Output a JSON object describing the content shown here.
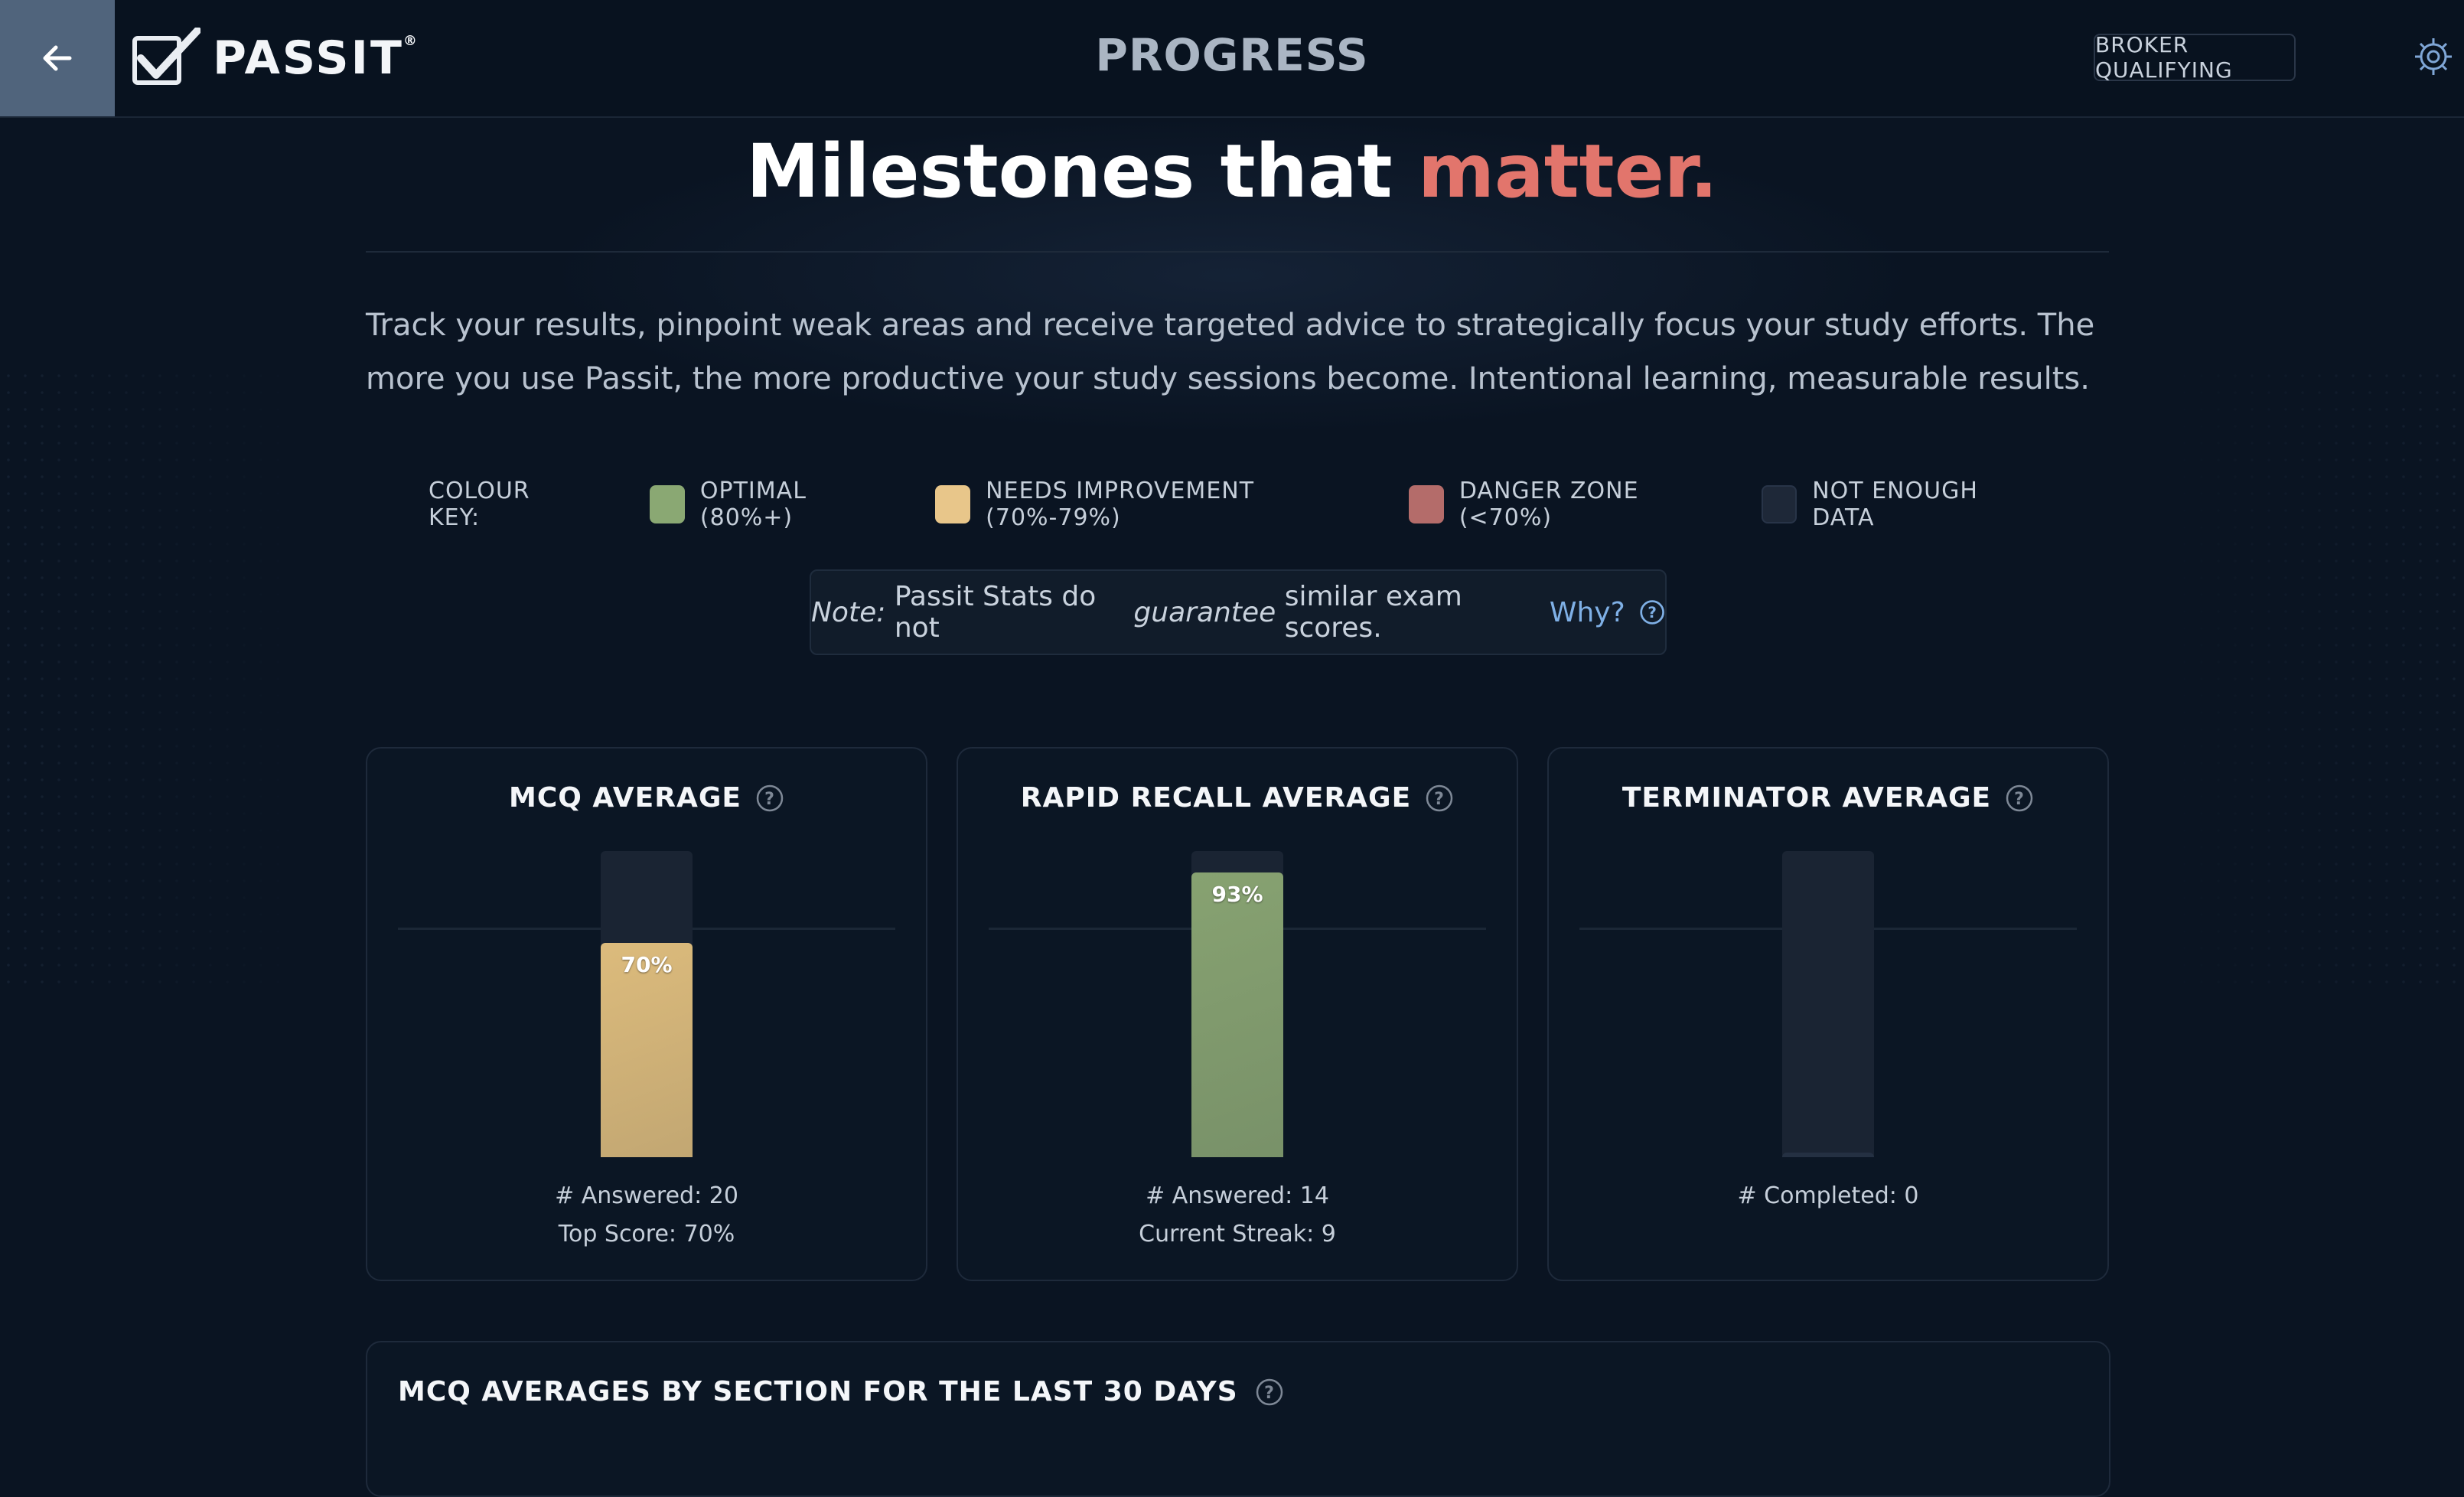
{
  "app": {
    "logo_text": "PASSIT",
    "page_title": "PROGRESS",
    "exam_button": "BROKER QUALIFYING"
  },
  "hero": {
    "title_main": "Milestones that",
    "title_accent": "matter.",
    "intro": "Track your results, pinpoint weak areas and receive targeted advice to strategically focus your study efforts. The more you use Passit, the more productive your study sessions become. Intentional learning, measurable results."
  },
  "colour_key": {
    "label": "COLOUR KEY:",
    "items": [
      {
        "label": "OPTIMAL (80%+)",
        "color": "#8aa873"
      },
      {
        "label": "NEEDS IMPROVEMENT (70%-79%)",
        "color": "#e8c68a"
      },
      {
        "label": "DANGER ZONE (<70%)",
        "color": "#b46c6a"
      },
      {
        "label": "NOT ENOUGH DATA",
        "color": "#1e2838"
      }
    ]
  },
  "note": {
    "prefix": "Note:",
    "text_1": "Passit Stats do not",
    "emphasis": "guarantee",
    "text_2": "similar exam scores.",
    "link": "Why?"
  },
  "cards": [
    {
      "title": "MCQ AVERAGE",
      "percent": 70,
      "bar_label": "70%",
      "color": "#dcbb7c",
      "stats": [
        "# Answered: 20",
        "Top Score: 70%"
      ]
    },
    {
      "title": "RAPID RECALL AVERAGE",
      "percent": 93,
      "bar_label": "93%",
      "color": "#87a271",
      "stats": [
        "# Answered: 14",
        "Current Streak: 9"
      ]
    },
    {
      "title": "TERMINATOR AVERAGE",
      "percent": 0,
      "bar_label": "",
      "color": "#1e2838",
      "stats": [
        "# Completed: 0"
      ]
    }
  ],
  "section": {
    "title": "MCQ AVERAGES BY SECTION FOR THE LAST 30 DAYS"
  }
}
